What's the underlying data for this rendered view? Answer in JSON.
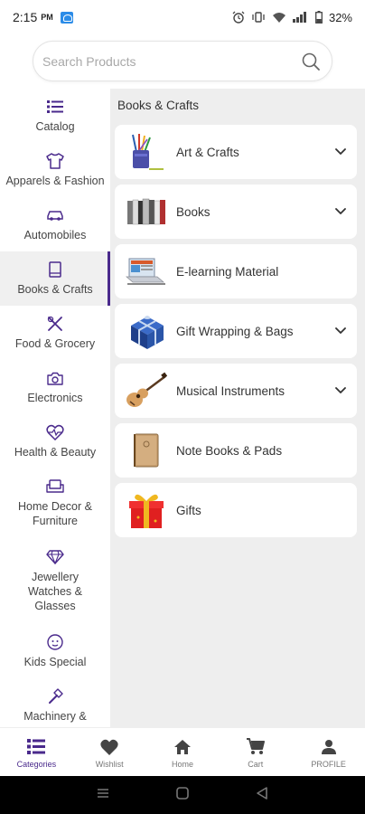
{
  "status_bar": {
    "time": "2:15",
    "ampm": "PM",
    "battery": "32%"
  },
  "search": {
    "placeholder": "Search Products"
  },
  "sidebar": {
    "items": [
      {
        "label": "Catalog",
        "icon": "list-icon"
      },
      {
        "label": "Apparels & Fashion",
        "icon": "tshirt-icon"
      },
      {
        "label": "Automobiles",
        "icon": "car-icon"
      },
      {
        "label": "Books & Crafts",
        "icon": "book-icon",
        "active": true
      },
      {
        "label": "Food & Grocery",
        "icon": "utensils-icon"
      },
      {
        "label": "Electronics",
        "icon": "camera-icon"
      },
      {
        "label": "Health & Beauty",
        "icon": "heart-pulse-icon"
      },
      {
        "label": "Home Decor & Furniture",
        "icon": "sofa-icon"
      },
      {
        "label": "Jewellery Watches & Glasses",
        "icon": "diamond-icon"
      },
      {
        "label": "Kids Special",
        "icon": "baby-icon"
      },
      {
        "label": "Machinery &",
        "icon": "hammer-icon"
      }
    ]
  },
  "main": {
    "title": "Books & Crafts",
    "categories": [
      {
        "label": "Art & Crafts",
        "has_children": true,
        "icon": "pencil-cup-image"
      },
      {
        "label": "Books",
        "has_children": true,
        "icon": "books-image"
      },
      {
        "label": "E-learning Material",
        "has_children": false,
        "icon": "laptop-image"
      },
      {
        "label": "Gift Wrapping & Bags",
        "has_children": true,
        "icon": "gift-box-image"
      },
      {
        "label": "Musical Instruments",
        "has_children": true,
        "icon": "guitar-image"
      },
      {
        "label": "Note Books & Pads",
        "has_children": false,
        "icon": "notebook-image"
      },
      {
        "label": "Gifts",
        "has_children": false,
        "icon": "gift-image"
      }
    ]
  },
  "bottom_nav": {
    "items": [
      {
        "label": "Categories",
        "icon": "categories-icon",
        "active": true
      },
      {
        "label": "Wishlist",
        "icon": "heart-icon"
      },
      {
        "label": "Home",
        "icon": "home-icon"
      },
      {
        "label": "Cart",
        "icon": "cart-icon"
      },
      {
        "label": "PROFILE",
        "icon": "profile-icon"
      }
    ]
  },
  "colors": {
    "accent": "#4a2a8c",
    "panel_bg": "#eeeeee"
  }
}
